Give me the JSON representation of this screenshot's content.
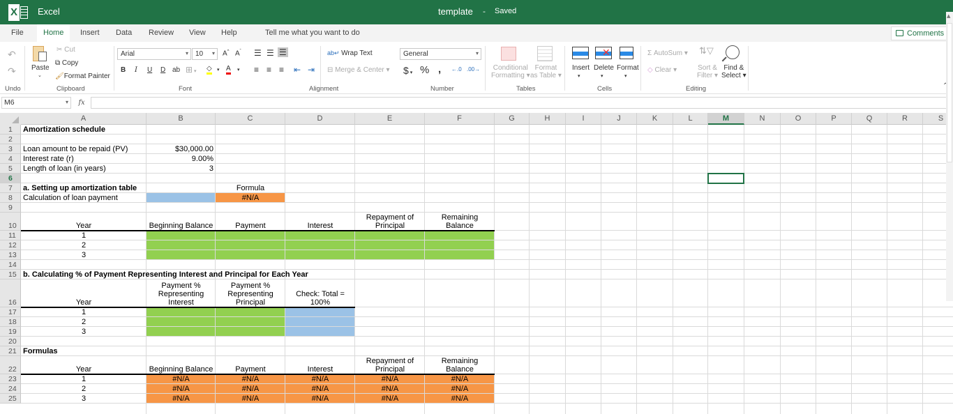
{
  "app": {
    "name": "Excel",
    "doc_title": "template",
    "separator": "-",
    "status": "Saved",
    "brand_color": "#217346"
  },
  "menu": {
    "tabs": [
      "File",
      "Home",
      "Insert",
      "Data",
      "Review",
      "View",
      "Help"
    ],
    "active": "Home",
    "tell_me": "Tell me what you want to do",
    "comments": "Comments"
  },
  "ribbon": {
    "undo": {
      "group": "Undo"
    },
    "clipboard": {
      "paste": "Paste",
      "cut": "Cut",
      "copy": "Copy",
      "format_painter": "Format Painter",
      "group": "Clipboard"
    },
    "font": {
      "name": "Arial",
      "size": "10",
      "grow": "A",
      "shrink": "A",
      "bold": "B",
      "italic": "I",
      "underline": "U",
      "double_underline": "D",
      "strike": "ab",
      "group": "Font"
    },
    "alignment": {
      "wrap_text": "Wrap Text",
      "merge_center": "Merge & Center",
      "group": "Alignment"
    },
    "number": {
      "format": "General",
      "currency": "$",
      "percent": "%",
      "comma": "̩,",
      "group": "Number"
    },
    "tables": {
      "conditional_1": "Conditional",
      "conditional_2": "Formatting",
      "format_table_1": "Format",
      "format_table_2": "as Table",
      "group": "Tables"
    },
    "cells": {
      "insert": "Insert",
      "delete": "Delete",
      "format": "Format",
      "group": "Cells"
    },
    "editing": {
      "autosum": "AutoSum",
      "clear": "Clear",
      "sort_1": "Sort &",
      "sort_2": "Filter",
      "find_1": "Find &",
      "find_2": "Select",
      "group": "Editing"
    }
  },
  "formula_bar": {
    "name_box": "M6",
    "fx": "fx",
    "formula": ""
  },
  "sheet": {
    "columns": [
      "A",
      "B",
      "C",
      "D",
      "E",
      "F",
      "G",
      "H",
      "I",
      "J",
      "K",
      "L",
      "M",
      "N",
      "O",
      "P",
      "Q",
      "R",
      "S"
    ],
    "selected_column": "M",
    "selected_row": "6",
    "active_cell": "M6",
    "rows": [
      "1",
      "2",
      "3",
      "4",
      "5",
      "6",
      "7",
      "8",
      "9",
      "10",
      "11",
      "12",
      "13",
      "14",
      "15",
      "16",
      "17",
      "18",
      "19",
      "20",
      "21",
      "22",
      "23",
      "24",
      "25"
    ],
    "cells": {
      "A1": "Amortization schedule",
      "A3": "Loan amount to be repaid (PV)",
      "B3": "$30,000.00",
      "A4": "Interest rate  (r)",
      "B4": "9.00%",
      "A5": "Length of loan (in years)",
      "B5": "3",
      "A7": "a.  Setting up amortization table",
      "C7": "Formula",
      "A8": "Calculation of loan payment",
      "C8": "#N/A",
      "A10": "Year",
      "B10": "Beginning Balance",
      "C10": "Payment",
      "D10": "Interest",
      "E10": "Repayment of Principal",
      "F10": "Remaining Balance",
      "A11": "1",
      "A12": "2",
      "A13": "3",
      "A15": "b.  Calculating % of Payment Representing Interest and Principal for Each Year",
      "A16": "Year",
      "B16": "Payment % Representing Interest",
      "C16": "Payment % Representing Principal",
      "D16": "Check:  Total = 100%",
      "A17": "1",
      "A18": "2",
      "A19": "3",
      "A21": "Formulas",
      "A22": "Year",
      "B22": "Beginning Balance",
      "C22": "Payment",
      "D22": "Interest",
      "E22": "Repayment of Principal",
      "F22": "Remaining Balance",
      "A23": "1",
      "A24": "2",
      "A25": "3",
      "na": "#N/A"
    },
    "fill_colors": {
      "blue": "#9bc2e6",
      "orange": "#f79646",
      "green": "#92d050"
    }
  }
}
